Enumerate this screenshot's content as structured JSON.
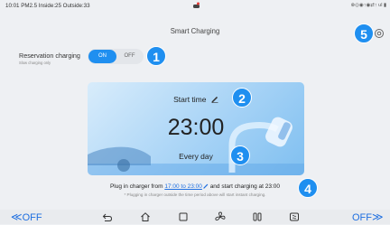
{
  "status_bar": {
    "left_text": "10:01 PM2.5 Inside:25 Outside:33",
    "right_text": "⊗◎◉↑◉⇄↑ ul ▮"
  },
  "page": {
    "title": "Smart Charging"
  },
  "reservation": {
    "label": "Reservation charging",
    "sublabel": "Slow charging only",
    "toggle_on": "ON",
    "toggle_off": "OFF"
  },
  "card": {
    "start_label": "Start time",
    "time": "23:00",
    "repeat": "Every day"
  },
  "info": {
    "prefix": "Plug in charger from ",
    "range": "17:00 to 23:00",
    "suffix": " and start charging at 23:00",
    "note": "* Plugging in charger outside the time period above will start instant charging."
  },
  "badges": [
    "1",
    "2",
    "3",
    "4",
    "5"
  ],
  "navbar": {
    "left_label": "OFF",
    "right_label": "OFF"
  },
  "colors": {
    "accent": "#1f8ff0",
    "link": "#1f6fe0"
  }
}
